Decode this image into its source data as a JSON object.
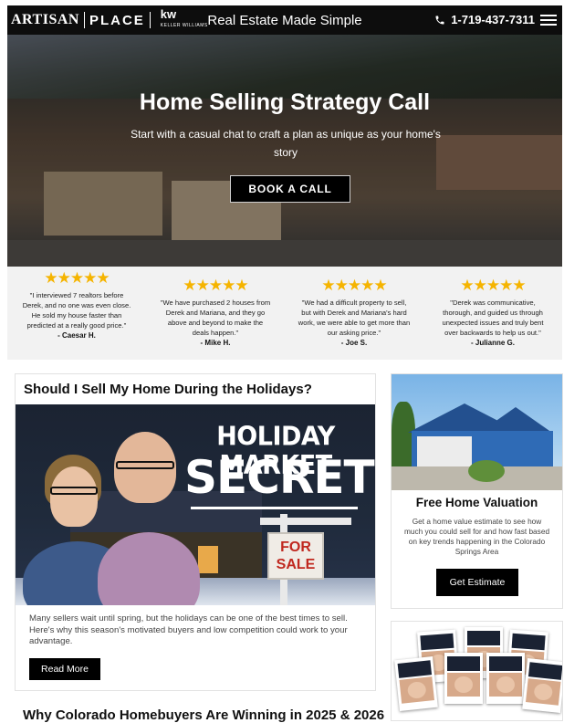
{
  "header": {
    "logo_artisan": "ARTISAN",
    "logo_place": "PLACE",
    "logo_kw": "kw",
    "logo_kw_sub": "KELLER WILLIAMS",
    "tagline": "Real Estate Made Simple",
    "phone": "1-719-437-7311"
  },
  "hero": {
    "title": "Home Selling Strategy Call",
    "subtitle": "Start with a casual chat to craft a plan as unique as your home's story",
    "cta_label": "BOOK A CALL"
  },
  "reviews": [
    {
      "stars": "★★★★★",
      "rating": 5,
      "text": "\"I interviewed 7 realtors before Derek, and no one was even close. He sold my house faster than predicted at a really good price.\"",
      "author": "- Caesar H."
    },
    {
      "stars": "★★★★★",
      "rating": 5,
      "text": "\"We have purchased 2 houses from Derek and Mariana, and they go above and beyond to make the deals happen.\"",
      "author": "- Mike H."
    },
    {
      "stars": "★★★★★",
      "rating": 5,
      "text": "\"We had a difficult property to sell, but with Derek and Mariana's hard work, we were able to get more than our asking price.\"",
      "author": "- Joe S."
    },
    {
      "stars": "★★★★★",
      "rating": 5,
      "text": "\"Derek was communicative, thorough, and guided us through unexpected issues and truly bent over backwards to help us out.\"",
      "author": "- Julianne G."
    }
  ],
  "article": {
    "title": "Should I Sell My Home During the Holidays?",
    "thumb_line1": "HOLIDAY MARKET",
    "thumb_line2": "SECRETS",
    "sign_line1": "FOR",
    "sign_line2": "SALE",
    "excerpt": "Many sellers wait until spring, but the holidays can be one of the best times to sell. Here's why this season's motivated buyers and low competition could work to your advantage.",
    "button_label": "Read More"
  },
  "next_article": {
    "title": "Why Colorado Homebuyers Are Winning in 2025 & 2026"
  },
  "sidebar": {
    "valuation_title": "Free Home Valuation",
    "valuation_text": "Get a home value estimate to see how much you could sell for and how fast based on key trends happening in the Colorado Springs Area",
    "valuation_button": "Get Estimate"
  },
  "colors": {
    "header_bg": "#0d0d0d",
    "button_bg": "#000000",
    "star": "#f5b400",
    "review_bg": "#f2f2f2"
  }
}
